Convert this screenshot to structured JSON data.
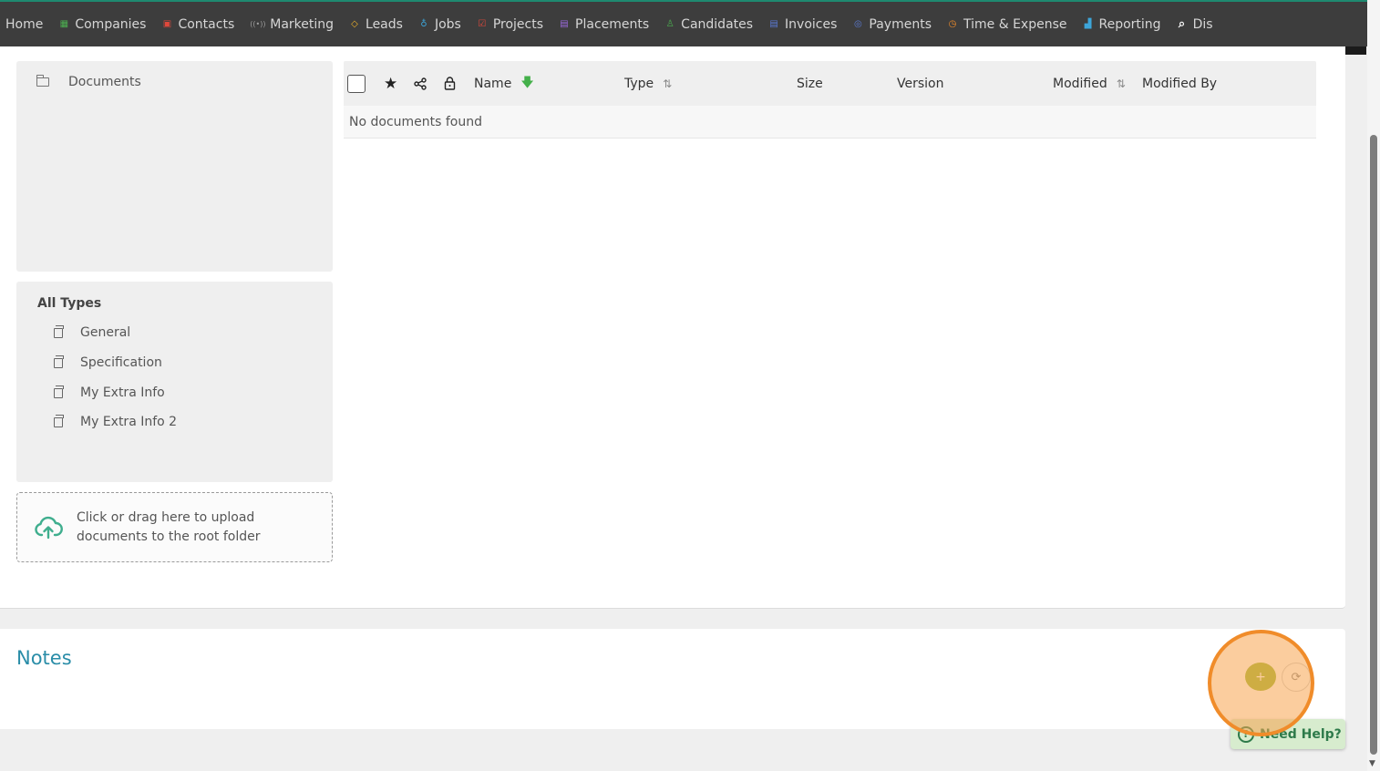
{
  "nav": {
    "items": [
      {
        "label": "Home",
        "icon": "home-icon",
        "color": "#d6d6d6",
        "glyph": ""
      },
      {
        "label": "Companies",
        "icon": "building-icon",
        "color": "#4caf50",
        "glyph": "▦"
      },
      {
        "label": "Contacts",
        "icon": "contact-card-icon",
        "color": "#e0483b",
        "glyph": "▣"
      },
      {
        "label": "Marketing",
        "icon": "broadcast-icon",
        "color": "#9e9e9e",
        "glyph": "((•))"
      },
      {
        "label": "Leads",
        "icon": "diamond-icon",
        "color": "#f0b429",
        "glyph": "◇"
      },
      {
        "label": "Jobs",
        "icon": "trophy-icon",
        "color": "#3da5d9",
        "glyph": "♁"
      },
      {
        "label": "Projects",
        "icon": "checkbox-icon",
        "color": "#e0483b",
        "glyph": "☑"
      },
      {
        "label": "Placements",
        "icon": "briefcase-icon",
        "color": "#9c6ade",
        "glyph": "▤"
      },
      {
        "label": "Candidates",
        "icon": "person-icon",
        "color": "#4caf50",
        "glyph": "♙"
      },
      {
        "label": "Invoices",
        "icon": "document-icon",
        "color": "#5b7bd5",
        "glyph": "▤"
      },
      {
        "label": "Payments",
        "icon": "coins-icon",
        "color": "#5b7bd5",
        "glyph": "◎"
      },
      {
        "label": "Time & Expense",
        "icon": "clock-icon",
        "color": "#f08c2a",
        "glyph": "◷"
      },
      {
        "label": "Reporting",
        "icon": "bar-chart-icon",
        "color": "#3da5d9",
        "glyph": "▟"
      },
      {
        "label": "Dis",
        "icon": "search-icon",
        "color": "#ffffff",
        "glyph": "⌕"
      }
    ]
  },
  "folders": {
    "root_label": "Documents"
  },
  "types": {
    "title": "All Types",
    "items": [
      "General",
      "Specification",
      "My Extra Info",
      "My Extra Info 2"
    ]
  },
  "upload": {
    "text": "Click or drag here to upload documents to the root folder"
  },
  "table": {
    "columns": {
      "name": "Name",
      "type": "Type",
      "size": "Size",
      "version": "Version",
      "modified": "Modified",
      "modified_by": "Modified By"
    },
    "empty_message": "No documents found"
  },
  "notes": {
    "title": "Notes",
    "add_glyph": "+",
    "refresh_glyph": "⟳"
  },
  "help": {
    "label": "Need Help?"
  }
}
